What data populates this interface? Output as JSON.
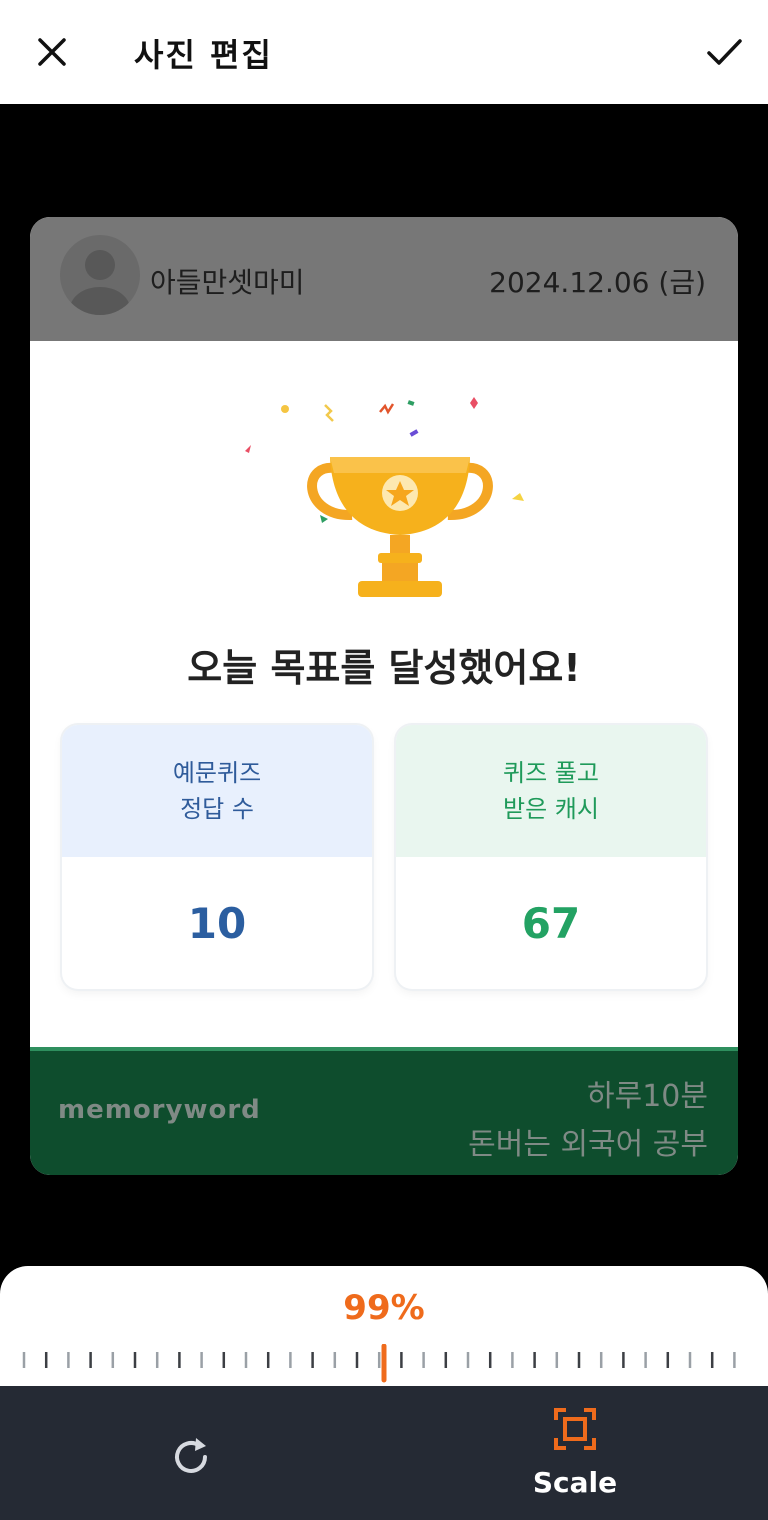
{
  "header": {
    "title": "사진 편집"
  },
  "post": {
    "username": "아들만셋마미",
    "date": "2024.12.06 (금)",
    "headline": "오늘 목표를 달성했어요!",
    "stats": [
      {
        "label_line1": "예문퀴즈",
        "label_line2": "정답 수",
        "value": "10"
      },
      {
        "label_line1": "퀴즈 풀고",
        "label_line2": "받은 캐시",
        "value": "67"
      }
    ],
    "footer": {
      "brand": "memoryword",
      "slogan_line1": "하루10분",
      "slogan_line2": "돈버는 외국어 공부"
    }
  },
  "scale": {
    "value_text": "99%",
    "level_percent": 99
  },
  "toolbar": {
    "scale_label": "Scale"
  },
  "colors": {
    "accent": "#ef6b1c",
    "bottom_bar": "#252a34",
    "footer_green": "#0e4d2d"
  }
}
